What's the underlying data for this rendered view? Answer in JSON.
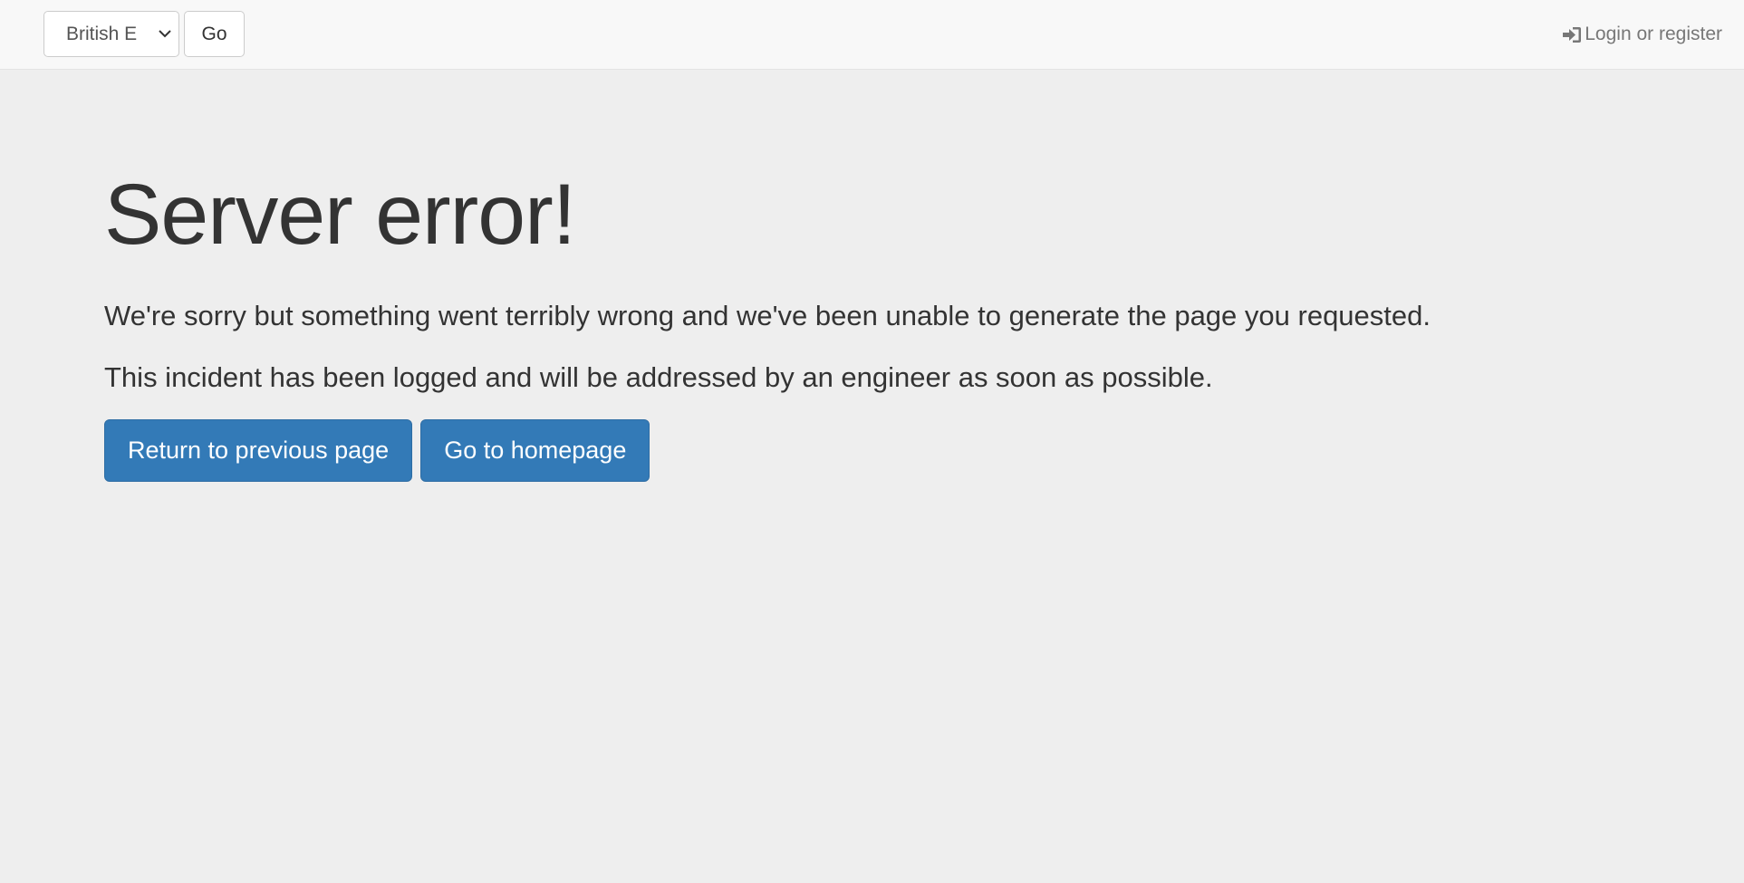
{
  "navbar": {
    "language_select": {
      "selected": "British E"
    },
    "go_label": "Go",
    "login_label": "Login or register",
    "login_icon": "sign-in-icon"
  },
  "main": {
    "title": "Server error!",
    "message_1": "We're sorry but something went terribly wrong and we've been unable to generate the page you requested.",
    "message_2": "This incident has been logged and will be addressed by an engineer as soon as possible.",
    "back_button": "Return to previous page",
    "home_button": "Go to homepage"
  },
  "colors": {
    "page_background": "#eeeeee",
    "navbar_background": "#f8f8f8",
    "primary_button": "#337ab7",
    "text": "#333333",
    "muted_text": "#777777"
  }
}
